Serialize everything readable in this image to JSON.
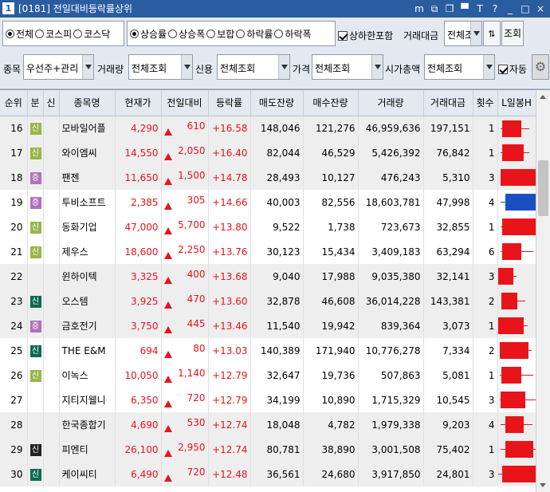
{
  "window": {
    "badge": "1",
    "title": "[0181] 전일대비등락률상위",
    "buttons_icons": [
      "m-icon",
      "restore-icon",
      "copy-icon",
      "pin-icon",
      "font-size-icon",
      "help-icon",
      "minimize-icon",
      "maximize-icon",
      "close-icon"
    ],
    "buttons_text": [
      "m",
      "⧉",
      "❐",
      "▀",
      "T",
      "?",
      "_",
      "□",
      "×"
    ]
  },
  "market_radios": [
    {
      "label": "전체",
      "checked": true
    },
    {
      "label": "코스피",
      "checked": false
    },
    {
      "label": "코스닥",
      "checked": false
    }
  ],
  "sort_radios": [
    {
      "label": "상승률",
      "checked": true
    },
    {
      "label": "상승폭",
      "checked": false
    },
    {
      "label": "보합",
      "checked": false
    },
    {
      "label": "하락률",
      "checked": false
    },
    {
      "label": "하락폭",
      "checked": false
    }
  ],
  "include_limit": {
    "label": "상하한포함",
    "checked": true
  },
  "trade_amount": {
    "label": "거래대금",
    "value": "전체조",
    "button": "조회"
  },
  "row2": {
    "item": {
      "label": "종목",
      "value": "우선주+관리"
    },
    "volume": {
      "label": "거래량",
      "value": "전체조회"
    },
    "credit": {
      "label": "신용",
      "value": "전체조회"
    },
    "price": {
      "label": "가격",
      "value": "전체조회"
    },
    "mktcap": {
      "label": "시가총액",
      "value": "전체조회"
    },
    "auto": {
      "label": "자동",
      "checked": true
    }
  },
  "columns": [
    "순위",
    "분",
    "신",
    "종목명",
    "현재가",
    "전일대비",
    "등락률",
    "매도잔량",
    "매수잔량",
    "거래량",
    "거래대금",
    "횟수",
    "L일봉H"
  ],
  "colors": {
    "red": "#e8141a",
    "blue": "#1a4fc4",
    "new": "#9ab44a",
    "jeung": "#b071b8",
    "sin": "#0b6b52"
  },
  "rows": [
    {
      "rank": "16",
      "cat": "신",
      "cat_cls": "cc-new",
      "credit": "",
      "name": "모바일어플",
      "price": "4,290",
      "diff": "610",
      "rate": "+16.58",
      "ask": "148,046",
      "bid": "121,276",
      "vol": "46,959,636",
      "amt": "197,151",
      "cnt": "1",
      "band": true,
      "candle": {
        "low": 0.08,
        "high": 0.82,
        "open": 0.12,
        "close": 0.62,
        "color": "red"
      }
    },
    {
      "rank": "17",
      "cat": "신",
      "cat_cls": "cc-new",
      "credit": "",
      "name": "와이엠씨",
      "price": "14,550",
      "diff": "2,050",
      "rate": "+16.40",
      "ask": "82,044",
      "bid": "46,529",
      "vol": "5,426,392",
      "amt": "76,842",
      "cnt": "1",
      "band": true,
      "candle": {
        "low": 0.08,
        "high": 0.82,
        "open": 0.12,
        "close": 0.68,
        "color": "red"
      }
    },
    {
      "rank": "18",
      "cat": "증",
      "cat_cls": "cc-jeung",
      "credit": "",
      "name": "팬젠",
      "price": "11,650",
      "diff": "1,500",
      "rate": "+14.78",
      "ask": "28,493",
      "bid": "10,127",
      "vol": "476,243",
      "amt": "5,310",
      "cnt": "3",
      "band": true,
      "candle": {
        "low": 0.08,
        "high": 0.98,
        "open": 0.08,
        "close": 0.98,
        "color": "red"
      }
    },
    {
      "rank": "19",
      "cat": "증",
      "cat_cls": "cc-jeung",
      "credit": "",
      "name": "투비소프트",
      "price": "2,385",
      "diff": "305",
      "rate": "+14.66",
      "ask": "40,003",
      "bid": "82,556",
      "vol": "18,603,781",
      "amt": "47,998",
      "cnt": "4",
      "band": false,
      "candle": {
        "low": 0.08,
        "high": 0.98,
        "open": 0.2,
        "close": 0.98,
        "color": "blue"
      }
    },
    {
      "rank": "20",
      "cat": "신",
      "cat_cls": "cc-new",
      "credit": "",
      "name": "동화기업",
      "price": "47,000",
      "diff": "5,700",
      "rate": "+13.80",
      "ask": "9,522",
      "bid": "1,738",
      "vol": "723,673",
      "amt": "32,855",
      "cnt": "1",
      "band": false,
      "candle": {
        "low": 0.08,
        "high": 0.98,
        "open": 0.12,
        "close": 0.98,
        "color": "red"
      }
    },
    {
      "rank": "21",
      "cat": "신",
      "cat_cls": "cc-new",
      "credit": "",
      "name": "제우스",
      "price": "18,600",
      "diff": "2,250",
      "rate": "+13.76",
      "ask": "30,123",
      "bid": "15,434",
      "vol": "3,409,183",
      "amt": "63,294",
      "cnt": "6",
      "band": false,
      "candle": {
        "low": 0.08,
        "high": 0.92,
        "open": 0.12,
        "close": 0.62,
        "color": "red"
      }
    },
    {
      "rank": "22",
      "cat": "",
      "cat_cls": "",
      "credit": "",
      "name": "윈하이텍",
      "price": "3,325",
      "diff": "400",
      "rate": "+13.68",
      "ask": "9,040",
      "bid": "17,988",
      "vol": "9,035,380",
      "amt": "32,141",
      "cnt": "3",
      "band": true,
      "candle": {
        "low": 0.02,
        "high": 0.48,
        "open": 0.02,
        "close": 0.4,
        "color": "red"
      }
    },
    {
      "rank": "23",
      "cat": "신",
      "cat_cls": "cc-sin",
      "credit": "",
      "name": "오스템",
      "price": "3,925",
      "diff": "470",
      "rate": "+13.60",
      "ask": "32,878",
      "bid": "46,608",
      "vol": "36,014,228",
      "amt": "143,381",
      "cnt": "2",
      "band": true,
      "candle": {
        "low": 0.1,
        "high": 0.72,
        "open": 0.1,
        "close": 0.52,
        "color": "red"
      }
    },
    {
      "rank": "24",
      "cat": "증",
      "cat_cls": "cc-jeung",
      "credit": "",
      "name": "금호전기",
      "price": "3,750",
      "diff": "445",
      "rate": "+13.46",
      "ask": "11,540",
      "bid": "19,942",
      "vol": "839,364",
      "amt": "3,073",
      "cnt": "1",
      "band": true,
      "candle": {
        "low": 0.02,
        "high": 0.78,
        "open": 0.02,
        "close": 0.68,
        "color": "red"
      }
    },
    {
      "rank": "25",
      "cat": "신",
      "cat_cls": "cc-sin",
      "credit": "",
      "name": "THE E&M",
      "price": "694",
      "diff": "80",
      "rate": "+13.03",
      "ask": "140,389",
      "bid": "171,940",
      "vol": "10,776,278",
      "amt": "7,334",
      "cnt": "2",
      "band": false,
      "candle": {
        "low": 0.05,
        "high": 0.88,
        "open": 0.05,
        "close": 0.8,
        "color": "red"
      }
    },
    {
      "rank": "26",
      "cat": "신",
      "cat_cls": "cc-new",
      "credit": "",
      "name": "이녹스",
      "price": "10,050",
      "diff": "1,140",
      "rate": "+12.79",
      "ask": "32,647",
      "bid": "19,736",
      "vol": "507,863",
      "amt": "5,081",
      "cnt": "1",
      "band": false,
      "candle": {
        "low": 0.05,
        "high": 0.92,
        "open": 0.1,
        "close": 0.62,
        "color": "red"
      }
    },
    {
      "rank": "27",
      "cat": "",
      "cat_cls": "",
      "credit": "",
      "name": "지티지웰니",
      "price": "6,350",
      "diff": "720",
      "rate": "+12.79",
      "ask": "34,199",
      "bid": "10,890",
      "vol": "1,715,329",
      "amt": "10,545",
      "cnt": "3",
      "band": false,
      "candle": {
        "low": 0.05,
        "high": 0.98,
        "open": 0.08,
        "close": 0.72,
        "color": "red"
      }
    },
    {
      "rank": "28",
      "cat": "",
      "cat_cls": "",
      "credit": "",
      "name": "한국종합기",
      "price": "4,690",
      "diff": "530",
      "rate": "+12.74",
      "ask": "18,048",
      "bid": "4,782",
      "vol": "1,979,338",
      "amt": "9,203",
      "cnt": "4",
      "band": true,
      "candle": {
        "low": 0.08,
        "high": 0.9,
        "open": 0.2,
        "close": 0.68,
        "color": "red"
      }
    },
    {
      "rank": "29",
      "cat": "신",
      "cat_cls": "cc-black",
      "credit": "",
      "name": "피엔티",
      "price": "26,100",
      "diff": "2,950",
      "rate": "+12.74",
      "ask": "80,781",
      "bid": "38,890",
      "vol": "3,001,508",
      "amt": "75,402",
      "cnt": "1",
      "band": true,
      "candle": {
        "low": 0.08,
        "high": 0.98,
        "open": 0.2,
        "close": 0.92,
        "color": "red"
      }
    },
    {
      "rank": "30",
      "cat": "신",
      "cat_cls": "cc-sin",
      "credit": "",
      "name": "케이씨티",
      "price": "6,490",
      "diff": "720",
      "rate": "+12.48",
      "ask": "36,561",
      "bid": "24,680",
      "vol": "3,917,850",
      "amt": "24,801",
      "cnt": "3",
      "band": true,
      "candle": {
        "low": 0.02,
        "high": 0.98,
        "open": 0.12,
        "close": 0.98,
        "color": "red"
      }
    }
  ]
}
